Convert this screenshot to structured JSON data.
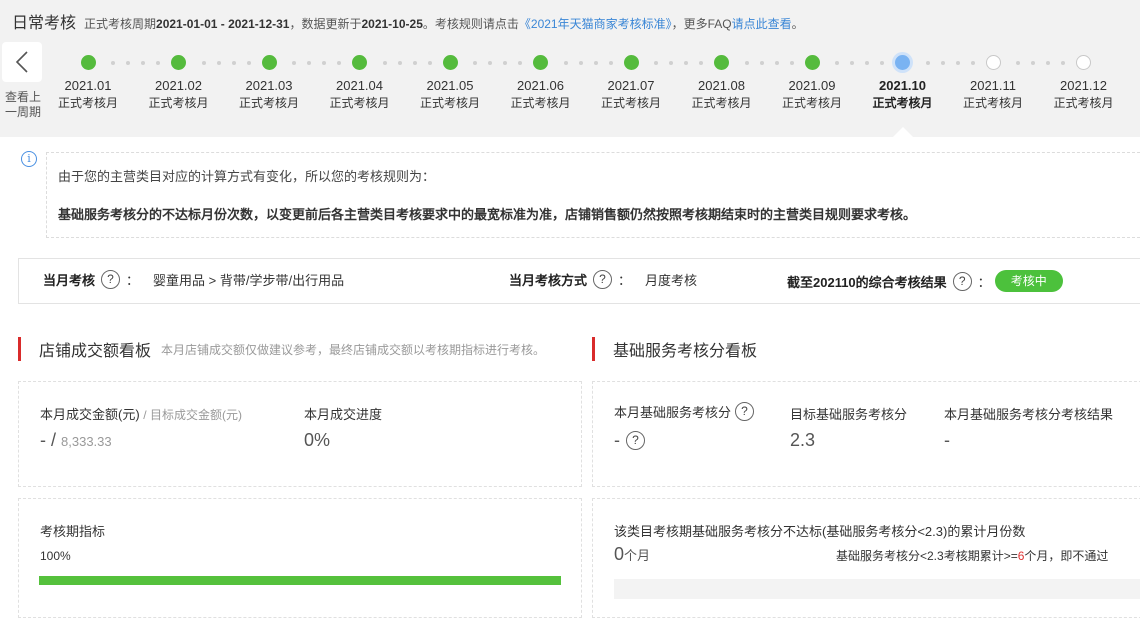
{
  "header": {
    "title": "日常考核",
    "note_prefix": "正式考核周期",
    "period": "2021-01-01 - 2021-12-31",
    "note_mid": "，数据更新于",
    "updated": "2021-10-25",
    "note_mid2": "。考核规则请点击",
    "rule_link": "《2021年天猫商家考核标准》",
    "note_mid3": "，更多FAQ",
    "faq_link": "请点此查看",
    "note_end": "。"
  },
  "timeline": {
    "prev_label": "查看上一周期",
    "months": [
      {
        "year": "2021.01",
        "sub": "正式考核月",
        "status": "done"
      },
      {
        "year": "2021.02",
        "sub": "正式考核月",
        "status": "done"
      },
      {
        "year": "2021.03",
        "sub": "正式考核月",
        "status": "done"
      },
      {
        "year": "2021.04",
        "sub": "正式考核月",
        "status": "done"
      },
      {
        "year": "2021.05",
        "sub": "正式考核月",
        "status": "done"
      },
      {
        "year": "2021.06",
        "sub": "正式考核月",
        "status": "done"
      },
      {
        "year": "2021.07",
        "sub": "正式考核月",
        "status": "done"
      },
      {
        "year": "2021.08",
        "sub": "正式考核月",
        "status": "done"
      },
      {
        "year": "2021.09",
        "sub": "正式考核月",
        "status": "done"
      },
      {
        "year": "2021.10",
        "sub": "正式考核月",
        "status": "current"
      },
      {
        "year": "2021.11",
        "sub": "正式考核月",
        "status": "todo"
      },
      {
        "year": "2021.12",
        "sub": "正式考核月",
        "status": "todo"
      }
    ]
  },
  "notice": {
    "line1": "由于您的主营类目对应的计算方式有变化，所以您的考核规则为：",
    "line2": "基础服务考核分的不达标月份次数，以变更前后各主营类目考核要求中的最宽标准为准，店铺销售额仍然按照考核期结束时的主营类目规则要求考核。"
  },
  "assessment": {
    "month_label": "当月考核",
    "category": "婴童用品 > 背带/学步带/出行用品",
    "method_label": "当月考核方式",
    "method": "月度考核",
    "result_label": "截至202110的综合考核结果",
    "result": "考核中",
    "q": "?",
    "colon": "："
  },
  "sales_board": {
    "title": "店铺成交额看板",
    "note": "本月店铺成交额仅做建议参考，最终店铺成交额以考核期指标进行考核。",
    "amount_label": "本月成交金额(元)",
    "target_label": "/ 目标成交金额(元)",
    "amount_value": "- /",
    "target_value": "8,333.33",
    "progress_label": "本月成交进度",
    "progress_value": "0%",
    "period_label": "考核期指标",
    "period_pct": "100%",
    "period_progress": 1.0
  },
  "service_board": {
    "title": "基础服务考核分看板",
    "score_label": "本月基础服务考核分",
    "score_value": "-",
    "target_label": "目标基础服务考核分",
    "target_value": "2.3",
    "result_label": "本月基础服务考核分考核结果",
    "result_value": "-",
    "fail_label": "该类目考核期基础服务考核分不达标(基础服务考核分<2.3)的累计月份数",
    "fail_count": "0",
    "fail_unit": "个月",
    "rule_prefix": "基础服务考核分<2.3考核期累计>=",
    "rule_num": "6",
    "rule_suffix": "个月，即不通过"
  },
  "colors": {
    "green": "#55bb3d",
    "current": "#7ab3f2",
    "accent_red": "#d92b2b",
    "link": "#3a86d6"
  }
}
